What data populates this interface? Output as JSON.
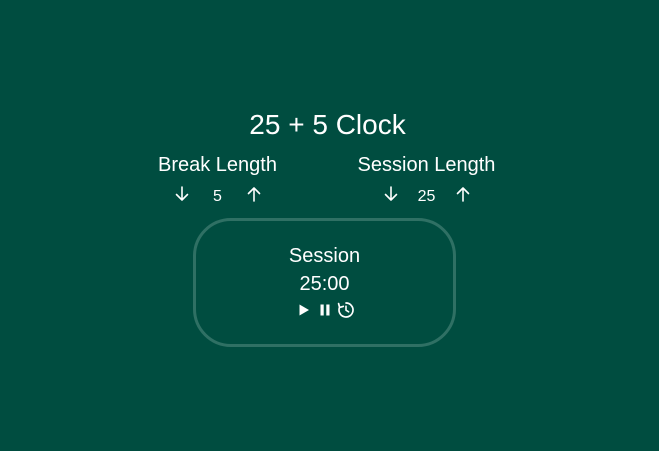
{
  "title": "25 + 5 Clock",
  "break": {
    "label": "Break Length",
    "value": "5",
    "decrement_icon": "arrow-down-icon",
    "increment_icon": "arrow-up-icon"
  },
  "session": {
    "label": "Session Length",
    "value": "25",
    "decrement_icon": "arrow-down-icon",
    "increment_icon": "arrow-up-icon"
  },
  "timer": {
    "label": "Session",
    "time_left": "25:00",
    "controls": [
      "play-icon",
      "pause-icon",
      "reset-icon"
    ]
  },
  "colors": {
    "background": "#004d40",
    "text": "#ffffff",
    "timer_border": "#2f7064"
  }
}
